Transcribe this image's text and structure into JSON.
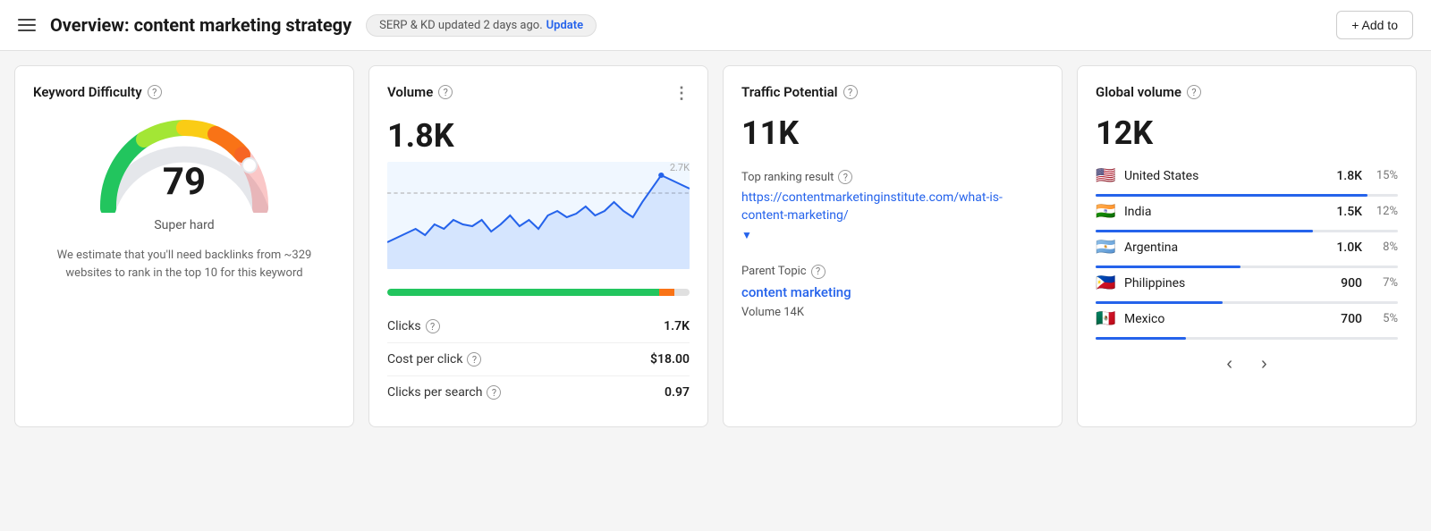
{
  "header": {
    "menu_icon": "☰",
    "title": "Overview: content marketing strategy",
    "badge_text": "SERP & KD updated 2 days ago.",
    "badge_update": "Update",
    "add_to_label": "+ Add to"
  },
  "keyword_difficulty": {
    "title": "Keyword Difficulty",
    "score": "79",
    "difficulty_label": "Super hard",
    "description": "We estimate that you'll need backlinks from ~329 websites to rank in the top 10 for this keyword"
  },
  "volume": {
    "title": "Volume",
    "value": "1.8K",
    "chart_max_label": "2.7K",
    "progress_green_pct": 90,
    "progress_orange_pct": 5,
    "stats": [
      {
        "label": "Clicks",
        "value": "1.7K"
      },
      {
        "label": "Cost per click",
        "value": "$18.00"
      },
      {
        "label": "Clicks per search",
        "value": "0.97"
      }
    ]
  },
  "traffic_potential": {
    "title": "Traffic Potential",
    "value": "11K",
    "top_ranking_label": "Top ranking result",
    "top_ranking_url": "https://contentmarketinginstitute.com/what-is-content-marketing/",
    "parent_topic_label": "Parent Topic",
    "parent_topic_link": "content marketing",
    "parent_volume_label": "Volume 14K"
  },
  "global_volume": {
    "title": "Global volume",
    "value": "12K",
    "countries": [
      {
        "flag": "🇺🇸",
        "name": "United States",
        "volume": "1.8K",
        "pct": "15%",
        "bar_pct": 15
      },
      {
        "flag": "🇮🇳",
        "name": "India",
        "volume": "1.5K",
        "pct": "12%",
        "bar_pct": 12
      },
      {
        "flag": "🇦🇷",
        "name": "Argentina",
        "volume": "1.0K",
        "pct": "8%",
        "bar_pct": 8
      },
      {
        "flag": "🇵🇭",
        "name": "Philippines",
        "volume": "900",
        "pct": "7%",
        "bar_pct": 7
      },
      {
        "flag": "🇲🇽",
        "name": "Mexico",
        "volume": "700",
        "pct": "5%",
        "bar_pct": 5
      }
    ],
    "prev_label": "‹",
    "next_label": "›"
  }
}
